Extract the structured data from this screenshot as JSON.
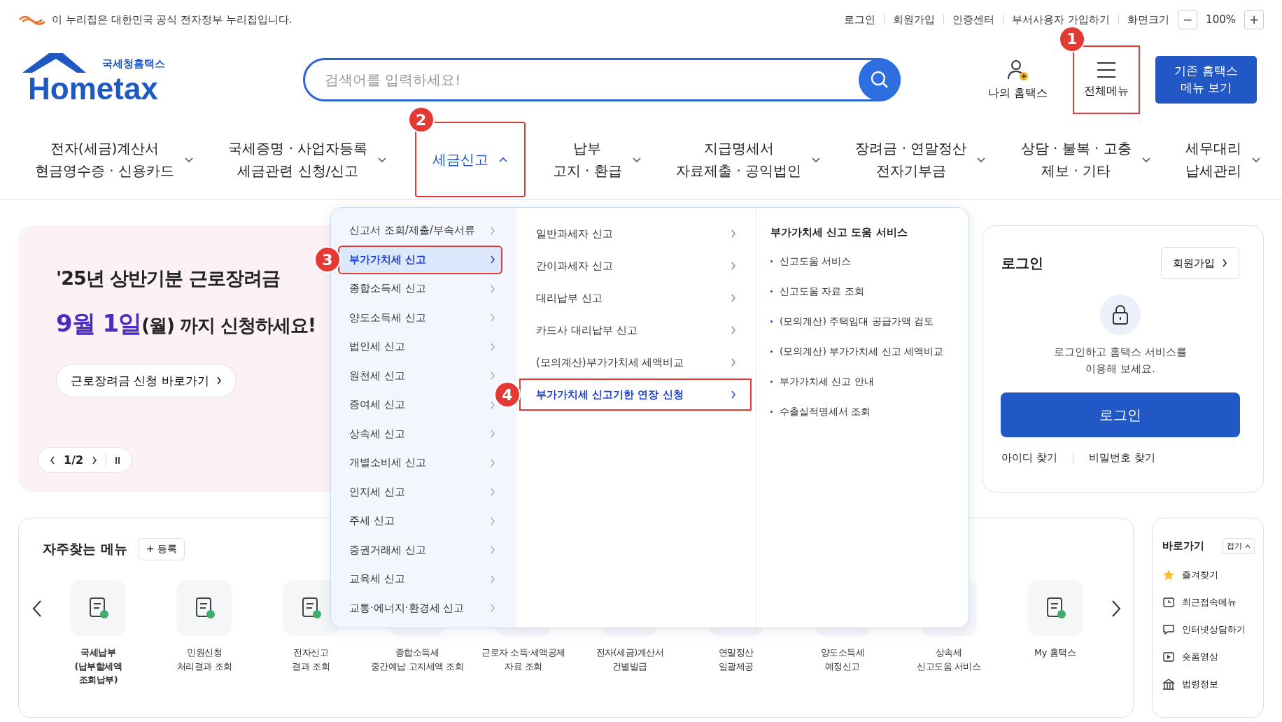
{
  "gov_bar": {
    "notice": "이 누리집은 대한민국 공식 전자정부 누리집입니다.",
    "links": [
      "로그인",
      "회원가입",
      "인증센터",
      "부서사용자 가입하기"
    ],
    "zoom_label": "화면크기",
    "zoom_minus": "−",
    "zoom_value": "100%",
    "zoom_plus": "+"
  },
  "header": {
    "logo_sub": "국세청홈택스",
    "logo_main": "Hometax",
    "search": {
      "placeholder": "검색어를 입력하세요!"
    },
    "my_label": "나의 홈택스",
    "all_menu": {
      "label": "전체메뉴",
      "callout": "1"
    },
    "legacy_button": "기존 홈택스\n메뉴 보기"
  },
  "nav": [
    {
      "label": "전자(세금)계산서\n현금영수증 · 신용카드",
      "selected": false
    },
    {
      "label": "국세증명 · 사업자등록\n세금관련 신청/신고",
      "selected": false
    },
    {
      "label": "세금신고",
      "selected": true,
      "callout": "2"
    },
    {
      "label": "납부\n고지 · 환급",
      "selected": false
    },
    {
      "label": "지급명세서\n자료제출 · 공익법인",
      "selected": false
    },
    {
      "label": "장려금 · 연말정산\n전자기부금",
      "selected": false
    },
    {
      "label": "상담 · 불복 · 고충\n제보 · 기타",
      "selected": false
    },
    {
      "label": "세무대리\n납세관리",
      "selected": false
    }
  ],
  "dropdown": {
    "categories": [
      {
        "label": "신고서 조회/제출/부속서류",
        "selected": false
      },
      {
        "label": "부가가치세 신고",
        "selected": true,
        "callout": "3"
      },
      {
        "label": "종합소득세 신고",
        "selected": false
      },
      {
        "label": "양도소득세 신고",
        "selected": false
      },
      {
        "label": "법인세 신고",
        "selected": false
      },
      {
        "label": "원천세 신고",
        "selected": false
      },
      {
        "label": "증여세 신고",
        "selected": false
      },
      {
        "label": "상속세 신고",
        "selected": false
      },
      {
        "label": "개별소비세 신고",
        "selected": false
      },
      {
        "label": "인지세 신고",
        "selected": false
      },
      {
        "label": "주세 신고",
        "selected": false
      },
      {
        "label": "증권거래세 신고",
        "selected": false
      },
      {
        "label": "교육세 신고",
        "selected": false
      },
      {
        "label": "교통·에너지·환경세 신고",
        "selected": false
      }
    ],
    "sub_items": [
      {
        "label": "일반과세자 신고",
        "selected": false
      },
      {
        "label": "간이과세자 신고",
        "selected": false
      },
      {
        "label": "대리납부 신고",
        "selected": false
      },
      {
        "label": "카드사 대리납부 신고",
        "selected": false
      },
      {
        "label": "(모의계산)부가가치세 세액비교",
        "selected": false
      },
      {
        "label": "부가가치세 신고기한 연장 신청",
        "selected": true,
        "callout": "4"
      }
    ],
    "help_title": "부가가치세 신고 도움 서비스",
    "help_links": [
      "신고도움 서비스",
      "신고도움 자료 조회",
      "(모의계산) 주택임대 공급가액 검토",
      "(모의계산) 부가가치세 신고 세액비교",
      "부가가치세 신고 안내",
      "수출실적명세서 조회"
    ]
  },
  "banner": {
    "title": "'25년 상반기분 근로장려금",
    "subtitle": "**9월 1일**(월) 까지 신청하세요!",
    "button": "근로장려금 신청 바로가기",
    "pager": "1/2"
  },
  "login": {
    "title": "로그인",
    "signup": "회원가입",
    "message": "로그인하고 홈택스 서비스를\n이용해 보세요.",
    "button": "로그인",
    "links": [
      "아이디 찾기",
      "비밀번호 찾기"
    ]
  },
  "quick_menu": {
    "title": "자주찾는 메뉴",
    "add_button": "+ 등록",
    "items": [
      "국세납부\n(납부할세액\n조회납부)",
      "민원신청\n처리결과 조회",
      "전자신고\n결과 조회",
      "종합소득세\n중간예납 고지세액 조회",
      "근로자 소득·세액공제\n자료 조회",
      "전자(세금)계산서\n건별발급",
      "연말정산\n일괄제공",
      "양도소득세\n예정신고",
      "상속세\n신고도움 서비스",
      "My 홈택스"
    ]
  },
  "shortcuts": {
    "title": "바로가기",
    "toggle": "접기",
    "items": [
      {
        "label": "즐겨찾기",
        "kind": "star"
      },
      {
        "label": "최근접속메뉴",
        "kind": "recent"
      },
      {
        "label": "인터넷상담하기",
        "kind": "chat"
      },
      {
        "label": "숏폼영상",
        "kind": "video"
      },
      {
        "label": "법령정보",
        "kind": "law"
      }
    ]
  }
}
